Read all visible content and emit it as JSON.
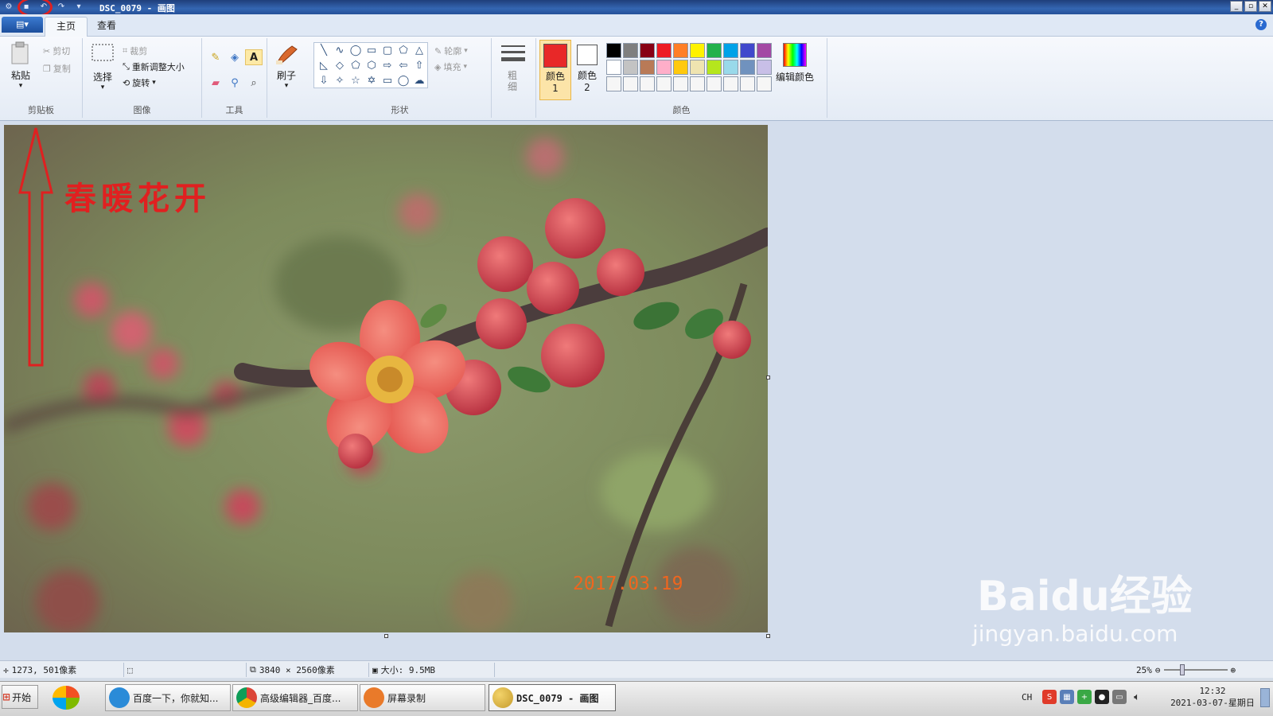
{
  "window": {
    "title": "DSC_0079 - 画图",
    "controls": [
      "_",
      "▫",
      "✕"
    ]
  },
  "tabs": {
    "app_menu": "▤▾",
    "home": "主页",
    "view": "查看"
  },
  "ribbon": {
    "clipboard": {
      "label": "剪贴板",
      "paste": "粘贴",
      "cut": "剪切",
      "copy": "复制"
    },
    "image": {
      "label": "图像",
      "select": "选择",
      "crop": "裁剪",
      "resize": "重新调整大小",
      "rotate": "旋转"
    },
    "tools": {
      "label": "工具"
    },
    "brush": {
      "label": "刷子"
    },
    "shapes": {
      "label": "形状",
      "outline": "轮廓",
      "fill": "填充"
    },
    "size": {
      "label": "粗细"
    },
    "colors": {
      "label": "颜色",
      "color1": "颜色1",
      "color2": "颜色2",
      "edit": "编辑颜色",
      "color1_value": "#e82828",
      "color2_value": "#ffffff",
      "palette_row1": [
        "#000000",
        "#7f7f7f",
        "#880015",
        "#ed1c24",
        "#ff7f27",
        "#fff200",
        "#22b14c",
        "#00a2e8",
        "#3f48cc",
        "#a349a4"
      ],
      "palette_row2": [
        "#ffffff",
        "#c3c3c3",
        "#b97a57",
        "#ffaec9",
        "#ffc90e",
        "#efe4b0",
        "#b5e61d",
        "#99d9ea",
        "#7092be",
        "#c8bfe7"
      ]
    }
  },
  "canvas": {
    "annotation_text": "春暖花开",
    "photo_date_stamp": "2017.03.19"
  },
  "status": {
    "cursor_pos": "1273, 501像素",
    "image_size": "3840 × 2560像素",
    "file_size": "大小: 9.5MB",
    "zoom": "25%"
  },
  "taskbar": {
    "start": "开始",
    "tasks": [
      {
        "label": "百度一下，你就知..."
      },
      {
        "label": "高级编辑器_百度..."
      },
      {
        "label": "屏幕录制"
      },
      {
        "label": "DSC_0079 - 画图"
      }
    ],
    "lang": "CH",
    "time": "12:32",
    "date": "2021-03-07-星期日"
  },
  "watermark": {
    "brand": "Baidu经验",
    "url": "jingyan.baidu.com"
  }
}
